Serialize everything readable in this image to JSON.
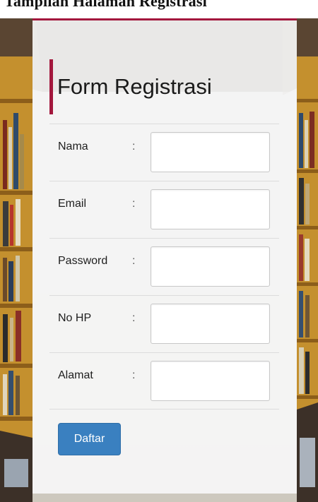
{
  "page_caption": "Tampilan Halaman Registrasi",
  "form": {
    "title": "Form Registrasi",
    "separator": ":",
    "fields": [
      {
        "label": "Nama",
        "value": "",
        "placeholder": ""
      },
      {
        "label": "Email",
        "value": "",
        "placeholder": ""
      },
      {
        "label": "Password",
        "value": "",
        "placeholder": ""
      },
      {
        "label": "No HP",
        "value": "",
        "placeholder": ""
      },
      {
        "label": "Alamat",
        "value": "",
        "placeholder": ""
      }
    ],
    "submit_label": "Daftar"
  },
  "colors": {
    "accent": "#a3173d",
    "button": "#3a80c0",
    "panel": "#f6f6f6"
  }
}
